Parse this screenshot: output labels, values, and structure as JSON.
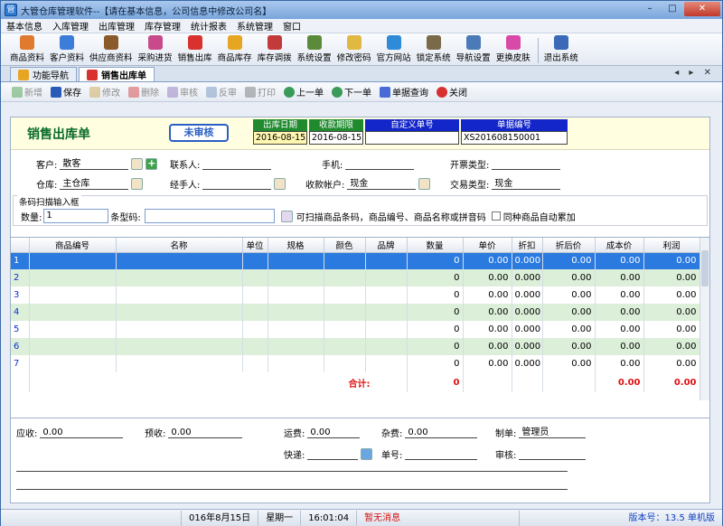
{
  "window": {
    "title": "大管仓库管理软件--【请在基本信息，公司信息中修改公司名】",
    "min": "–",
    "max": "□",
    "close": "✕"
  },
  "menu": [
    "基本信息",
    "入库管理",
    "出库管理",
    "库存管理",
    "统计报表",
    "系统管理",
    "窗口"
  ],
  "toolbar": [
    {
      "label": "商品资料",
      "color": "#e07a2e"
    },
    {
      "label": "客户资料",
      "color": "#3b7dd8"
    },
    {
      "label": "供应商资料",
      "color": "#8a5a2a"
    },
    {
      "label": "采购进货",
      "color": "#c94a8a"
    },
    {
      "label": "销售出库",
      "color": "#d8312e"
    },
    {
      "label": "商品库存",
      "color": "#e6a622"
    },
    {
      "label": "库存调拨",
      "color": "#c23a3a"
    },
    {
      "label": "系统设置",
      "color": "#5a8a3a"
    },
    {
      "label": "修改密码",
      "color": "#e0b842"
    },
    {
      "label": "官方网站",
      "color": "#2f8ad8"
    },
    {
      "label": "锁定系统",
      "color": "#7a6a4a"
    },
    {
      "label": "导航设置",
      "color": "#4a7ab8"
    },
    {
      "label": "更换皮肤",
      "color": "#d84aa8"
    },
    {
      "label": "退出系统",
      "color": "#3a6ab8"
    }
  ],
  "tabs": [
    {
      "label": "功能导航"
    },
    {
      "label": "销售出库单"
    }
  ],
  "tabnav": "◂ ▸ ✕",
  "actions": [
    {
      "label": "新增",
      "enabled": false
    },
    {
      "label": "保存",
      "enabled": true
    },
    {
      "label": "修改",
      "enabled": false
    },
    {
      "label": "删除",
      "enabled": false
    },
    {
      "label": "审核",
      "enabled": false
    },
    {
      "label": "反审",
      "enabled": false
    },
    {
      "label": "打印",
      "enabled": false
    },
    {
      "label": "上一单",
      "enabled": true
    },
    {
      "label": "下一单",
      "enabled": true
    },
    {
      "label": "单据查询",
      "enabled": true
    },
    {
      "label": "关闭",
      "enabled": true
    }
  ],
  "form": {
    "title": "销售出库单",
    "status": "未审核",
    "out_date_label": "出库日期",
    "out_date": "2016-08-15",
    "due_label": "收款期限",
    "due": "2016-08-15",
    "custom_label": "自定义单号",
    "custom": "",
    "docno_label": "单据编号",
    "docno": "XS201608150001",
    "customer_label": "客户:",
    "customer": "散客",
    "contact_label": "联系人:",
    "contact": "",
    "phone_label": "手机:",
    "phone": "",
    "invoice_label": "开票类型:",
    "invoice": "",
    "warehouse_label": "仓库:",
    "warehouse": "主仓库",
    "handler_label": "经手人:",
    "handler": "",
    "account_label": "收款帐户:",
    "account": "现金",
    "trade_label": "交易类型:",
    "trade": "现金"
  },
  "scan": {
    "legend": "条码扫描输入框",
    "qty_label": "数量:",
    "qty": "1",
    "code_label": "条型码:",
    "code": "",
    "hint": "可扫描商品条码，商品编号、商品名称或拼音码",
    "accumulate_label": "同种商品自动累加"
  },
  "grid": {
    "columns": [
      "",
      "商品编号",
      "名称",
      "单位",
      "规格",
      "颜色",
      "品牌",
      "数量",
      "单价",
      "折扣",
      "折后价",
      "成本价",
      "利润"
    ],
    "rows": [
      [
        "1",
        "",
        "",
        "",
        "",
        "",
        "",
        "0",
        "0.00",
        "0.000",
        "0.00",
        "0.00",
        "0.00"
      ],
      [
        "2",
        "",
        "",
        "",
        "",
        "",
        "",
        "0",
        "0.00",
        "0.000",
        "0.00",
        "0.00",
        "0.00"
      ],
      [
        "3",
        "",
        "",
        "",
        "",
        "",
        "",
        "0",
        "0.00",
        "0.000",
        "0.00",
        "0.00",
        "0.00"
      ],
      [
        "4",
        "",
        "",
        "",
        "",
        "",
        "",
        "0",
        "0.00",
        "0.000",
        "0.00",
        "0.00",
        "0.00"
      ],
      [
        "5",
        "",
        "",
        "",
        "",
        "",
        "",
        "0",
        "0.00",
        "0.000",
        "0.00",
        "0.00",
        "0.00"
      ],
      [
        "6",
        "",
        "",
        "",
        "",
        "",
        "",
        "0",
        "0.00",
        "0.000",
        "0.00",
        "0.00",
        "0.00"
      ],
      [
        "7",
        "",
        "",
        "",
        "",
        "",
        "",
        "0",
        "0.00",
        "0.000",
        "0.00",
        "0.00",
        "0.00"
      ]
    ],
    "total_label": "合计:",
    "total_qty": "0",
    "total_cost": "0.00",
    "total_profit": "0.00"
  },
  "footer": {
    "receivable_label": "应收:",
    "receivable": "0.00",
    "prepaid_label": "预收:",
    "prepaid": "0.00",
    "freight_label": "运费:",
    "freight": "0.00",
    "misc_label": "杂费:",
    "misc": "0.00",
    "maker_label": "制单:",
    "maker": "管理员",
    "express_label": "快递:",
    "express": "",
    "tracking_label": "单号:",
    "tracking": "",
    "reviewer_label": "审核:",
    "reviewer": ""
  },
  "status": {
    "date": "016年8月15日",
    "weekday": "星期一",
    "time": "16:01:04",
    "msg": "暂无消息",
    "version": "版本号：13.5 单机版"
  }
}
